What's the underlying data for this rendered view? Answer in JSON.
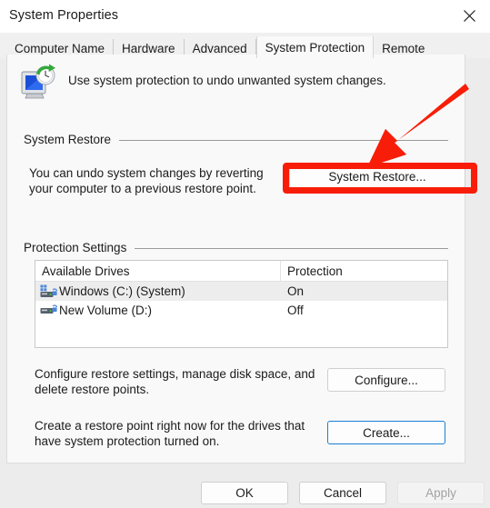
{
  "window": {
    "title": "System Properties",
    "close_icon": "close-icon"
  },
  "tabs": [
    {
      "label": "Computer Name",
      "active": false
    },
    {
      "label": "Hardware",
      "active": false
    },
    {
      "label": "Advanced",
      "active": false
    },
    {
      "label": "System Protection",
      "active": true
    },
    {
      "label": "Remote",
      "active": false
    }
  ],
  "header": {
    "icon": "system-protection-icon",
    "description": "Use system protection to undo unwanted system changes."
  },
  "system_restore": {
    "group_label": "System Restore",
    "description": "You can undo system changes by reverting your computer to a previous restore point.",
    "button_label": "System Restore..."
  },
  "protection_settings": {
    "group_label": "Protection Settings",
    "columns": [
      "Available Drives",
      "Protection"
    ],
    "rows": [
      {
        "drive": "Windows (C:) (System)",
        "protection": "On",
        "selected": true,
        "icon": "windows-drive-icon"
      },
      {
        "drive": "New Volume (D:)",
        "protection": "Off",
        "selected": false,
        "icon": "drive-icon"
      }
    ],
    "configure_description": "Configure restore settings, manage disk space, and delete restore points.",
    "configure_button": "Configure...",
    "create_description": "Create a restore point right now for the drives that have system protection turned on.",
    "create_button": "Create..."
  },
  "footer": {
    "ok": "OK",
    "cancel": "Cancel",
    "apply": "Apply",
    "apply_disabled": true
  },
  "annotation": {
    "color": "#f81d08",
    "target": "System Restore..."
  }
}
